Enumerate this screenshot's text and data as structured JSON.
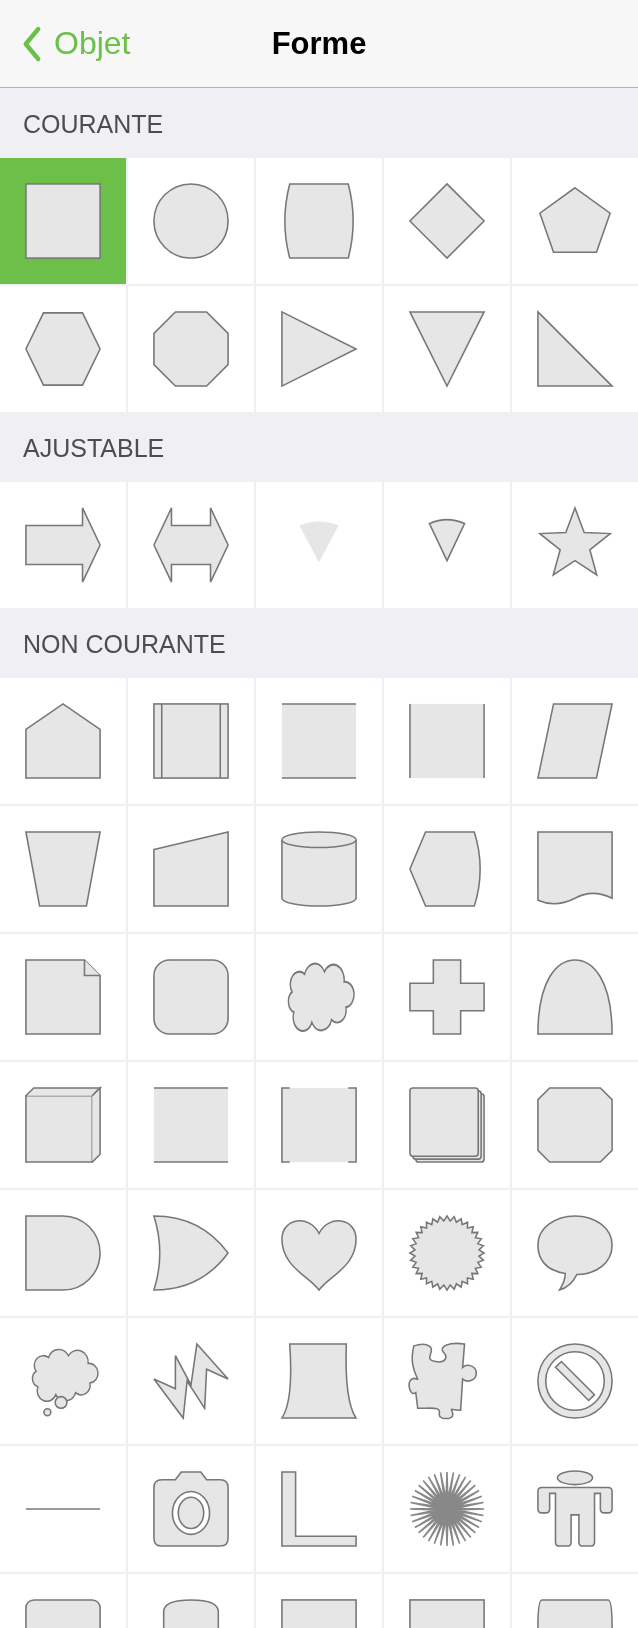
{
  "nav_bar": {
    "back_label": "Objet",
    "title": "Forme"
  },
  "sections": [
    {
      "title": "COURANTE",
      "cells": [
        {
          "kind": "square",
          "selected": true
        },
        {
          "kind": "circle",
          "selected": false
        },
        {
          "kind": "barrel",
          "selected": false
        },
        {
          "kind": "diamond",
          "selected": false
        },
        {
          "kind": "pentagon",
          "selected": false
        },
        {
          "kind": "hexagon",
          "selected": false
        },
        {
          "kind": "octagon",
          "selected": false
        },
        {
          "kind": "triangle-right",
          "selected": false
        },
        {
          "kind": "triangle-down",
          "selected": false
        },
        {
          "kind": "right-triangle",
          "selected": false
        }
      ]
    },
    {
      "title": "AJUSTABLE",
      "cells": [
        {
          "kind": "arrow",
          "selected": false
        },
        {
          "kind": "double-arrow",
          "selected": false
        },
        {
          "kind": "wedge",
          "selected": false
        },
        {
          "kind": "outlined-wedge",
          "selected": false
        },
        {
          "kind": "star",
          "selected": false
        }
      ]
    },
    {
      "title": "NON COURANTE",
      "cells": [
        {
          "kind": "house",
          "selected": false
        },
        {
          "kind": "framed-rectangle",
          "selected": false
        },
        {
          "kind": "top-bottom-rectangle",
          "selected": false
        },
        {
          "kind": "side-rectangle",
          "selected": false
        },
        {
          "kind": "parallelogram",
          "selected": false
        },
        {
          "kind": "trapezoid",
          "selected": false
        },
        {
          "kind": "slanted-rectangle",
          "selected": false
        },
        {
          "kind": "cylinder",
          "selected": false
        },
        {
          "kind": "display",
          "selected": false
        },
        {
          "kind": "document",
          "selected": false
        },
        {
          "kind": "folded-page",
          "selected": false
        },
        {
          "kind": "rounded-square",
          "selected": false
        },
        {
          "kind": "cloud",
          "selected": false
        },
        {
          "kind": "plus",
          "selected": false
        },
        {
          "kind": "arch",
          "selected": false
        },
        {
          "kind": "cube",
          "selected": false
        },
        {
          "kind": "top-bottom-rectangle",
          "selected": false
        },
        {
          "kind": "bracket-rectangle",
          "selected": false
        },
        {
          "kind": "stacked-squares",
          "selected": false
        },
        {
          "kind": "beveled-square",
          "selected": false
        },
        {
          "kind": "half-round",
          "selected": false
        },
        {
          "kind": "curved-arrowhead",
          "selected": false
        },
        {
          "kind": "heart",
          "selected": false
        },
        {
          "kind": "seal",
          "selected": false
        },
        {
          "kind": "speech-bubble",
          "selected": false
        },
        {
          "kind": "thought-bubble",
          "selected": false
        },
        {
          "kind": "lightning",
          "selected": false
        },
        {
          "kind": "flared-trapezoid",
          "selected": false
        },
        {
          "kind": "puzzle-piece",
          "selected": false
        },
        {
          "kind": "prohibited",
          "selected": false
        },
        {
          "kind": "line",
          "selected": false
        },
        {
          "kind": "camera",
          "selected": false
        },
        {
          "kind": "l-shape",
          "selected": false
        },
        {
          "kind": "sunburst",
          "selected": false
        },
        {
          "kind": "person",
          "selected": false
        },
        {
          "kind": "rounded-rectangle",
          "selected": false
        },
        {
          "kind": "tombstone",
          "selected": false
        },
        {
          "kind": "rectangle",
          "selected": false
        },
        {
          "kind": "rectangle",
          "selected": false
        },
        {
          "kind": "bulged-rectangle",
          "selected": false
        }
      ]
    }
  ]
}
